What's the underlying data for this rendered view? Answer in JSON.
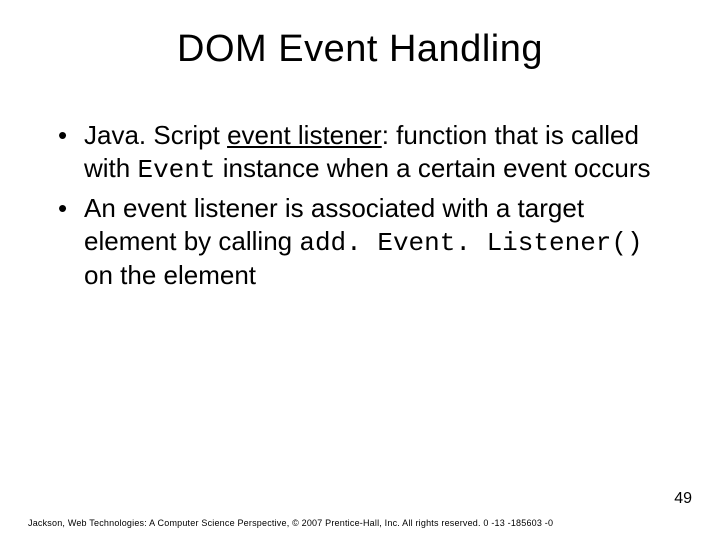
{
  "title": "DOM Event Handling",
  "bullets": [
    {
      "pre": "Java. Script ",
      "underlined": "event listener",
      "mid": ": function that is called with ",
      "code1": "Event",
      "post": " instance when a certain event occurs"
    },
    {
      "pre": "An event listener is associated with a target element by calling ",
      "code1": "add. Event. Listener()",
      "post": " on the element"
    }
  ],
  "page_number": "49",
  "footer": "Jackson, Web Technologies: A Computer Science Perspective, © 2007 Prentice-Hall, Inc. All rights reserved. 0 -13 -185603 -0"
}
